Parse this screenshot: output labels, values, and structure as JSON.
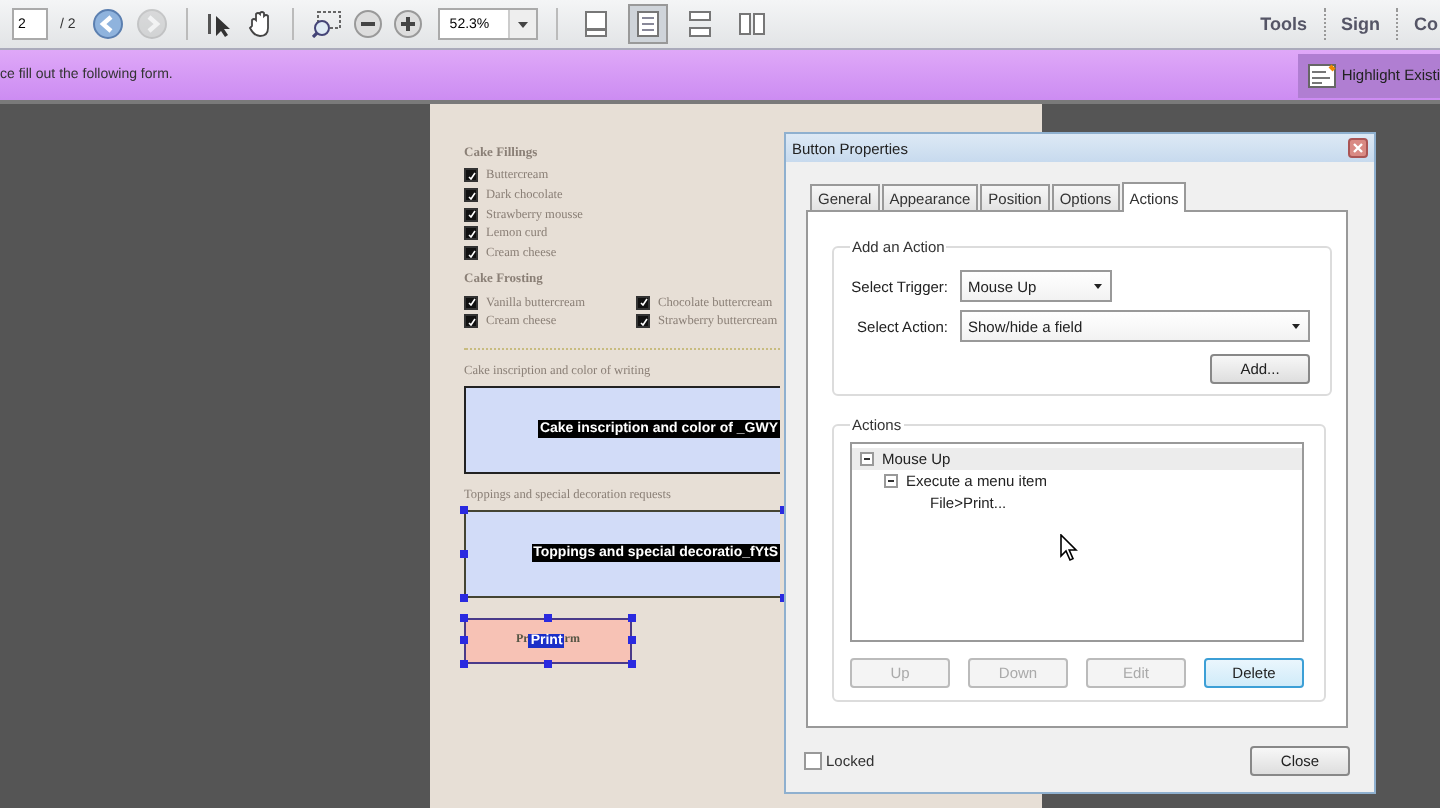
{
  "toolbar": {
    "page_number": "2",
    "page_total": "/ 2",
    "nav_buttons": [
      {
        "disabled": false
      },
      {
        "disabled": true
      }
    ],
    "zoom": "52.3%",
    "view_buttons": [
      {
        "selected": false
      },
      {
        "selected": true
      },
      {
        "selected": false
      },
      {
        "selected": false
      }
    ],
    "links": [
      "Tools",
      "Sign",
      "Co"
    ]
  },
  "message_bar": {
    "text": "ce fill out the following form.",
    "button": "Highlight Existi"
  },
  "form_page": {
    "fillings": {
      "heading": "Cake Fillings",
      "options": [
        {
          "label": "Buttercream",
          "checked": true
        },
        {
          "label": "Dark chocolate",
          "checked": true
        },
        {
          "label": "Strawberry mousse",
          "checked": true
        },
        {
          "label": "Lemon curd",
          "checked": true
        },
        {
          "label": "Cream cheese",
          "checked": true
        }
      ]
    },
    "frosting": {
      "heading": "Cake Frosting",
      "options": [
        {
          "label": "Vanilla buttercream",
          "checked": true
        },
        {
          "label": "Chocolate buttercream",
          "checked": true
        },
        {
          "label": "Cream cheese",
          "checked": true
        },
        {
          "label": "Strawberry buttercream",
          "checked": true
        }
      ]
    },
    "inscription": {
      "label": "Cake inscription and color of writing",
      "field_name": "Cake inscription and color of _GWY",
      "selected": false
    },
    "toppings": {
      "label": "Toppings and special decoration requests",
      "field_name": "Toppings and special decoratio_fYtS",
      "selected": true
    },
    "print_button": {
      "caption_start": "Pr",
      "field_name": "Print",
      "caption_end": "rm",
      "selected": true
    }
  },
  "dialog": {
    "title": "Button Properties",
    "tabs": [
      {
        "label": "General",
        "selected": false
      },
      {
        "label": "Appearance",
        "selected": false
      },
      {
        "label": "Position",
        "selected": false
      },
      {
        "label": "Options",
        "selected": false
      },
      {
        "label": "Actions",
        "selected": true
      }
    ],
    "add_group": {
      "title": "Add an Action",
      "trigger_label": "Select Trigger:",
      "trigger_value": "Mouse Up",
      "action_label": "Select Action:",
      "action_value": "Show/hide a field",
      "add_button": "Add..."
    },
    "actions_group": {
      "title": "Actions",
      "tree": [
        {
          "label": "Mouse Up",
          "expanded": true,
          "selected": true,
          "children": [
            {
              "label": "Execute a menu item",
              "expanded": true,
              "selected": false,
              "children": [
                {
                  "label": "File>Print...",
                  "selected": false
                }
              ]
            }
          ]
        }
      ],
      "buttons": [
        {
          "label": "Up",
          "disabled": true
        },
        {
          "label": "Down",
          "disabled": true
        },
        {
          "label": "Edit",
          "disabled": true
        },
        {
          "label": "Delete",
          "disabled": false
        }
      ]
    },
    "locked": {
      "label": "Locked",
      "checked": false
    },
    "close_button": "Close"
  }
}
